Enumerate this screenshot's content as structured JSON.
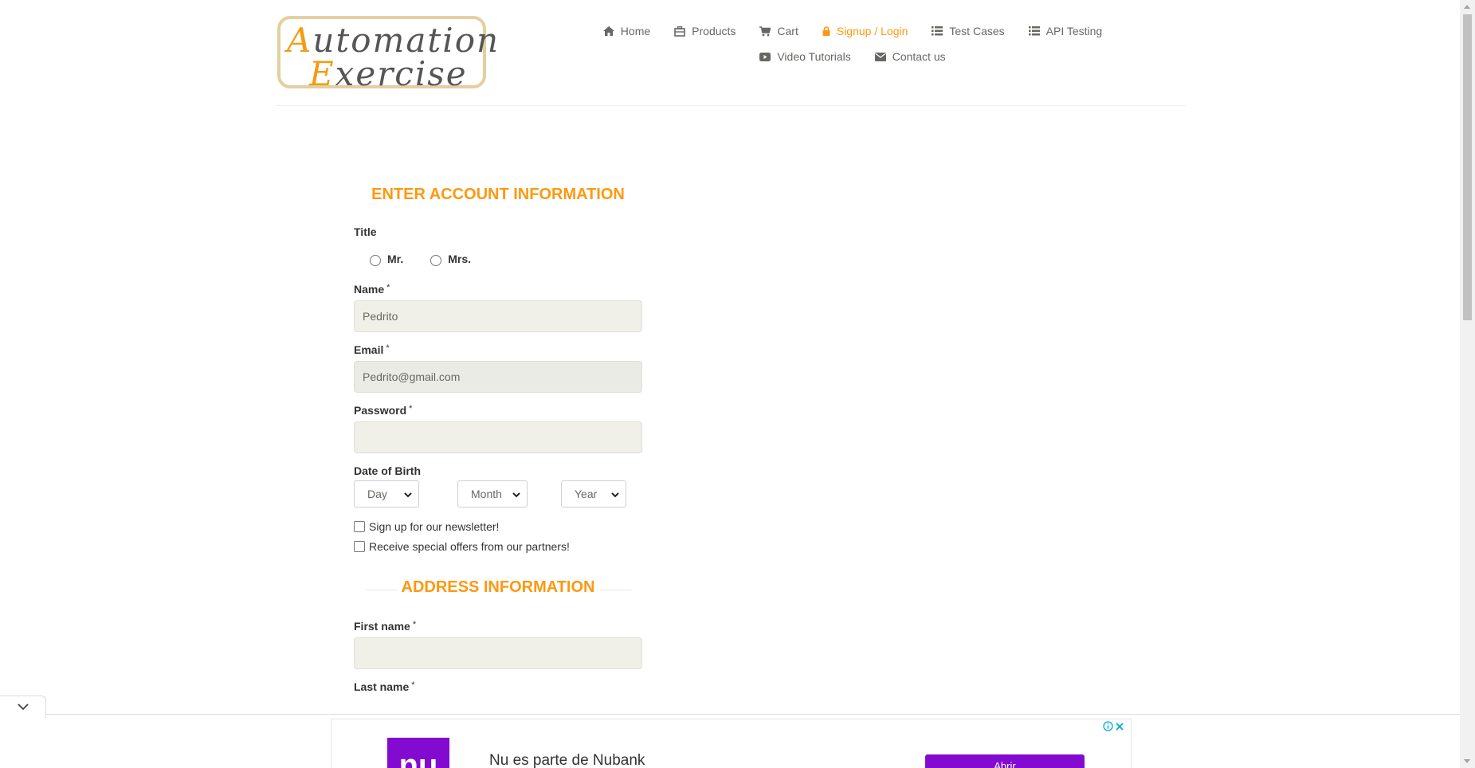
{
  "logo": {
    "line1": "Automation",
    "line2": "Exercise"
  },
  "nav": {
    "row1": [
      {
        "label": "Home",
        "icon": "home-icon",
        "active": false
      },
      {
        "label": "Products",
        "icon": "products-icon",
        "active": false
      },
      {
        "label": "Cart",
        "icon": "cart-icon",
        "active": false
      },
      {
        "label": "Signup / Login",
        "icon": "lock-icon",
        "active": true
      },
      {
        "label": "Test Cases",
        "icon": "list-icon",
        "active": false
      },
      {
        "label": "API Testing",
        "icon": "list-icon",
        "active": false
      }
    ],
    "row2": [
      {
        "label": "Video Tutorials",
        "icon": "youtube-play-icon",
        "active": false
      },
      {
        "label": "Contact us",
        "icon": "envelope-icon",
        "active": false
      }
    ]
  },
  "form": {
    "account_title": "ENTER ACCOUNT INFORMATION",
    "title_label": "Title",
    "title_options": [
      "Mr.",
      "Mrs."
    ],
    "name_label": "Name",
    "name_value": "Pedrito",
    "email_label": "Email",
    "email_value": "Pedrito@gmail.com",
    "password_label": "Password",
    "password_value": "",
    "dob_label": "Date of Birth",
    "dob_day": "Day",
    "dob_month": "Month",
    "dob_year": "Year",
    "newsletter_label": "Sign up for our newsletter!",
    "offers_label": "Receive special offers from our partners!",
    "required_mark": "*",
    "address_title": "ADDRESS INFORMATION",
    "first_name_label": "First name",
    "first_name_value": "",
    "last_name_label": "Last name"
  },
  "ad": {
    "logo_text": "nu",
    "text": "Nu es parte de Nubank",
    "button": "Abrir"
  },
  "colors": {
    "accent": "#fe980f",
    "nav_text": "#696763",
    "input_bg": "#f0f0e9",
    "ad_purple": "#820ad1"
  }
}
